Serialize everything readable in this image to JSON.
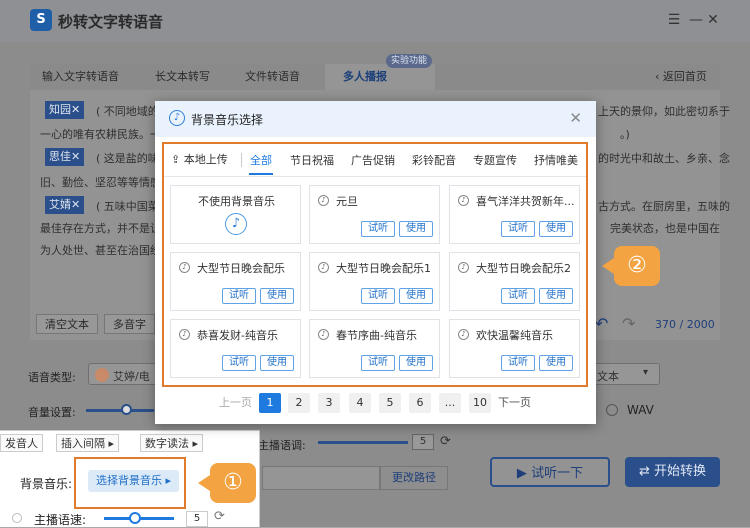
{
  "app": {
    "title": "秒转文字转语音",
    "logo_letter": "S",
    "tabs": [
      "输入文字转语音",
      "长文本转写",
      "文件转语音",
      "多人播报"
    ],
    "badge": "实验功能",
    "back": "返回首页",
    "speakers": [
      {
        "name": "知园✕",
        "text1": "( 不同地域的",
        "text1b": "上天的景仰，如此密切系于",
        "text2": "一心的唯有农耕民族。一",
        "text2b": "。)"
      },
      {
        "name": "思佳✕",
        "text1": "( 这是盐的味",
        "text1b": "的时光中和故土、乡亲、念",
        "text2": "旧、勤俭、坚忍等等情感",
        "text2b": ""
      },
      {
        "name": "艾婧✕",
        "text1": "( 五味中国菜",
        "text1b": "古方式。在厨房里，五味的",
        "text2": "最佳存在方式，并不是让",
        "text2b": "完美状态，也是中国在",
        "text3": "为人处世、甚至在治国经",
        "text3b": ""
      }
    ],
    "clear_text": "清空文本",
    "multi_sound": "多音字",
    "count": "370 / 2000",
    "voice_type_label": "语音类型:",
    "voice_name": "艾婷/电",
    "volume_label": "音量设置:",
    "text_label": "文本",
    "wav_label": "WAV",
    "anchor_speed_label": "主播语调:",
    "anchor_speed_value": "5",
    "change_path": "更改路径",
    "listen_btn": "试听一下",
    "convert_btn": "开始转换"
  },
  "inset": {
    "tabs": [
      "发音人",
      "插入间隔 ▸",
      "数字读法 ▸"
    ],
    "bgm_label": "背景音乐:",
    "bgm_button": "选择背景音乐 ▸",
    "speed_label": "主播语速:",
    "speed_value": "5"
  },
  "markers": {
    "one": "①",
    "two": "②"
  },
  "modal": {
    "title": "背景音乐选择",
    "local_upload": "本地上传",
    "categories": [
      "全部",
      "节日祝福",
      "广告促销",
      "彩铃配音",
      "专题宣传",
      "抒情唯美"
    ],
    "cards": [
      {
        "name": "不使用背景音乐",
        "none": true
      },
      {
        "name": "元旦"
      },
      {
        "name": "喜气洋洋共贺新年..."
      },
      {
        "name": "大型节日晚会配乐"
      },
      {
        "name": "大型节日晚会配乐1"
      },
      {
        "name": "大型节日晚会配乐2"
      },
      {
        "name": "恭喜发财-纯音乐"
      },
      {
        "name": "春节序曲-纯音乐"
      },
      {
        "name": "欢快温馨纯音乐"
      }
    ],
    "listen": "试听",
    "use": "使用",
    "pagination": {
      "prev": "上一页",
      "pages": [
        "1",
        "2",
        "3",
        "4",
        "5",
        "6",
        "...",
        "10"
      ],
      "next": "下一页",
      "current": "1"
    }
  },
  "colors": {
    "accent": "#1f7ae0",
    "marker": "#f3a341",
    "highlight_border": "#e07b2e"
  }
}
